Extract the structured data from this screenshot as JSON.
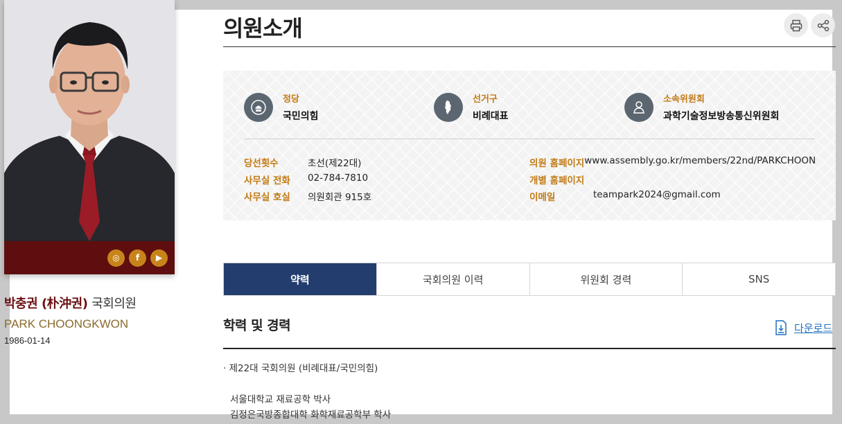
{
  "page": {
    "title": "의원소개"
  },
  "profile": {
    "name_ko": "박충권 (朴沖권)",
    "name_suffix": "국회의원",
    "name_en": "PARK CHOONGKWON",
    "birth": "1986-01-14",
    "social": [
      {
        "icon": "instagram-icon",
        "glyph": "◎"
      },
      {
        "icon": "facebook-icon",
        "glyph": "f"
      },
      {
        "icon": "youtube-icon",
        "glyph": "▶"
      }
    ]
  },
  "summary": {
    "party_label": "정당",
    "party_value": "국민의힘",
    "district_label": "선거구",
    "district_value": "비례대표",
    "committee_label": "소속위원회",
    "committee_value": "과학기술정보방송통신위원회"
  },
  "details": {
    "terms_label": "당선횟수",
    "terms_value": "초선(제22대)",
    "phone_label": "사무실 전화",
    "phone_value": "02-784-7810",
    "room_label": "사무실 호실",
    "room_value": "의원회관 915호",
    "homepage_label": "의원 홈페이지",
    "homepage_value": "www.assembly.go.kr/members/22nd/PARKCHOONG",
    "personal_label": "개별 홈페이지",
    "personal_value": "",
    "email_label": "이메일",
    "email_value": "teampark2024@gmail.com"
  },
  "tabs": [
    {
      "label": "약력",
      "active": true
    },
    {
      "label": "국회의원 이력",
      "active": false
    },
    {
      "label": "위원회 경력",
      "active": false
    },
    {
      "label": "SNS",
      "active": false
    }
  ],
  "career": {
    "title": "학력 및 경력",
    "download_label": "다운로드",
    "current": "· 제22대 국회의원 (비례대표/국민의힘)",
    "items": [
      "서울대학교 재료공학 박사",
      "김정은국방종합대학 화학재료공학부 학사"
    ]
  },
  "colors": {
    "accent_gold": "#c27a14",
    "brand_maroon": "#5e0e0e",
    "tab_active": "#233e6e",
    "link_blue": "#1e6fc0"
  }
}
